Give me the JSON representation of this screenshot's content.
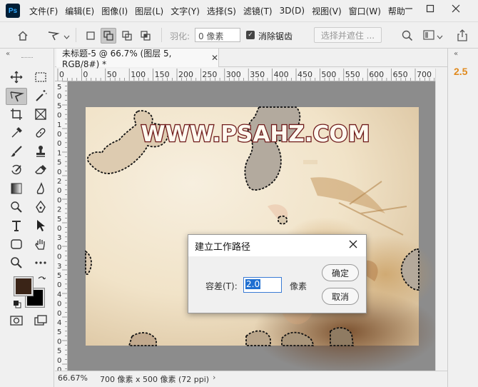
{
  "menu": {
    "logo": "Ps",
    "items": [
      "文件(F)",
      "编辑(E)",
      "图像(I)",
      "图层(L)",
      "文字(Y)",
      "选择(S)",
      "滤镜(T)",
      "3D(D)",
      "视图(V)",
      "窗口(W)",
      "帮助"
    ]
  },
  "options": {
    "feather_label": "羽化:",
    "feather_value": "0 像素",
    "antialias_label": "消除锯齿",
    "select_mask_label": "选择并遮住 ..."
  },
  "document": {
    "tab_title": "未标题-5 @ 66.7% (图层 5, RGB/8#) *",
    "watermark": "WWW.PSAHZ.COM",
    "zoom": "66.67%",
    "size_info": "700 像素 x 500 像素 (72 ppi)"
  },
  "ruler": {
    "h_labels": [
      "0",
      "0",
      "50",
      "100",
      "150",
      "200",
      "250",
      "300",
      "350",
      "400",
      "450",
      "500",
      "550",
      "600",
      "650",
      "700"
    ],
    "v_labels": [
      "5",
      "0",
      "5",
      "0",
      "1",
      "0",
      "0",
      "1",
      "5",
      "0",
      "2",
      "0",
      "0",
      "2",
      "5",
      "0",
      "3",
      "0",
      "0",
      "3",
      "5",
      "0",
      "4",
      "0",
      "0",
      "4",
      "5",
      "0",
      "5",
      "0",
      "0"
    ]
  },
  "right_panel": {
    "value": "2.5"
  },
  "dialog": {
    "title": "建立工作路径",
    "tolerance_label": "容差(T):",
    "tolerance_value": "2.0",
    "unit": "像素",
    "ok": "确定",
    "cancel": "取消"
  },
  "colors": {
    "foreground": "#3a2417",
    "background": "#000000",
    "accent": "#e08a1e"
  }
}
